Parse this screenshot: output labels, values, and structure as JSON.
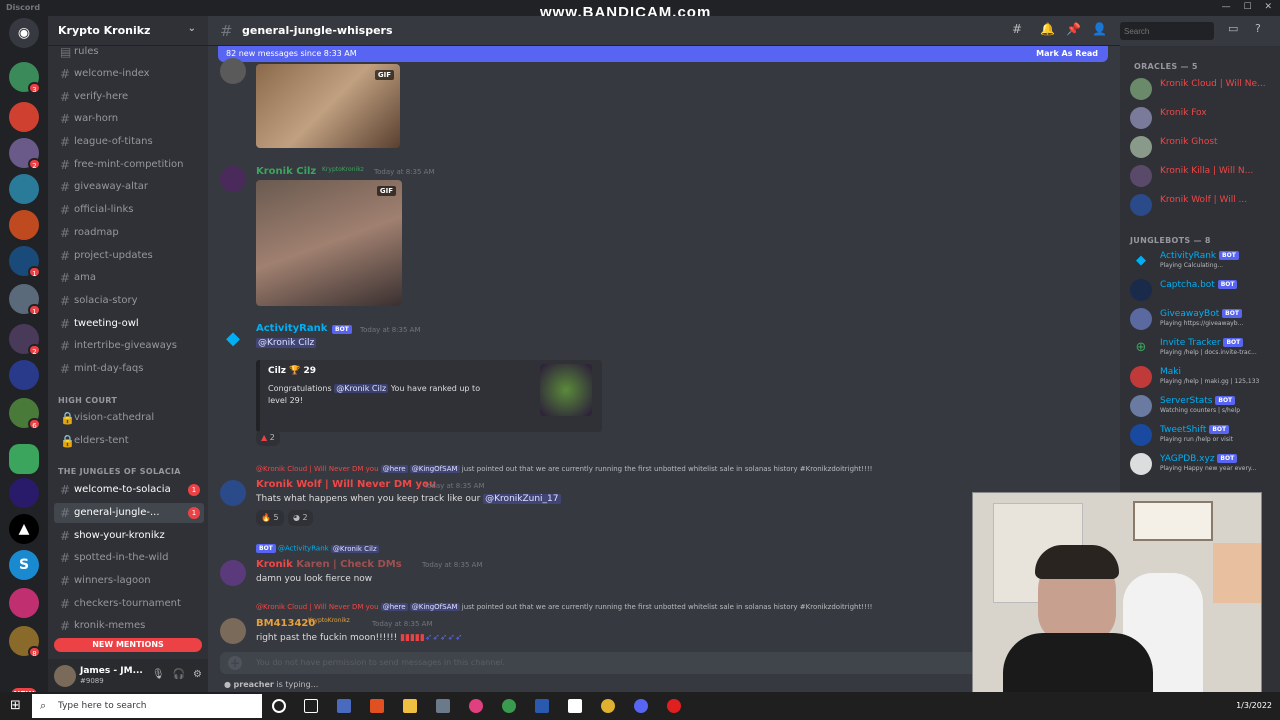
{
  "titlebar": {
    "app": "Discord",
    "watermark": "www.BANDICAM.com"
  },
  "server": {
    "name": "Krypto Kronikz"
  },
  "guild_badges": [
    "3",
    "2",
    "1",
    "1",
    "2",
    "6",
    "1",
    "8"
  ],
  "guild_new_label": "NEW",
  "channels": {
    "top": [
      {
        "label": "rules"
      },
      {
        "label": "welcome-index"
      },
      {
        "label": "verify-here"
      },
      {
        "label": "war-horn"
      },
      {
        "label": "league-of-titans"
      },
      {
        "label": "free-mint-competition"
      },
      {
        "label": "giveaway-altar"
      },
      {
        "label": "official-links"
      },
      {
        "label": "roadmap"
      },
      {
        "label": "project-updates"
      },
      {
        "label": "ama"
      },
      {
        "label": "solacia-story"
      },
      {
        "label": "tweeting-owl"
      },
      {
        "label": "intertribe-giveaways"
      },
      {
        "label": "mint-day-faqs"
      }
    ],
    "cat_high_court": "HIGH COURT",
    "high_court": [
      {
        "label": "vision-cathedral"
      },
      {
        "label": "elders-tent"
      }
    ],
    "cat_jungles": "THE JUNGLES OF SOLACIA",
    "jungles": [
      {
        "label": "welcome-to-solacia",
        "badge": "1"
      },
      {
        "label": "general-jungle-...",
        "badge": "1"
      },
      {
        "label": "show-your-kronikz"
      },
      {
        "label": "spotted-in-the-wild"
      },
      {
        "label": "winners-lagoon"
      },
      {
        "label": "checkers-tournament"
      },
      {
        "label": "kronik-memes"
      }
    ],
    "new_mentions": "NEW MENTIONS"
  },
  "user": {
    "name": "James - JM...",
    "tag": "#9089"
  },
  "chat": {
    "channel_title": "general-jungle-whispers",
    "new_messages": "82 new messages since 8:33 AM",
    "mark_read": "Mark As Read",
    "gif_label": "GIF",
    "search_placeholder": "Search",
    "msg1": {
      "author": "Kronik Cilz",
      "server_tag": "KryptoKronikz",
      "time": "Today at 8:35 AM"
    },
    "msg2": {
      "author": "ActivityRank",
      "bot": "BOT",
      "time": "Today at 8:35 AM",
      "mention": "@Kronik Cilz",
      "embed_title": "Cilz",
      "embed_level": "29",
      "embed_text_a": "Congratulations",
      "embed_mention": "@Kronik Cilz",
      "embed_text_b": "You have ranked up to",
      "embed_text_c": "level 29!",
      "reaction_count": "2"
    },
    "msg3": {
      "reply_author": "@Kronik Cloud | Will Never DM you",
      "reply_here": "@here",
      "reply_mention": "@KingOfSAM",
      "reply_text": "just pointed out that we are currently running the first unbotted whitelist sale in solanas history",
      "reply_tail": "#Kronikzdoitright!!!!",
      "author": "Kronik Wolf | Will Never DM you",
      "time": "Today at 8:35 AM",
      "text": "Thats what happens when you keep track like our",
      "mention": "@KronikZuni_17",
      "r1": "5",
      "r2": "2"
    },
    "msg4": {
      "reply_bot": "BOT",
      "reply_author": "@ActivityRank",
      "reply_mention": "@Kronik Cilz",
      "author": "Kronik",
      "author_tail": "Karen | Check DMs",
      "time": "Today at 8:35 AM",
      "text": "damn you look fierce now"
    },
    "msg5": {
      "reply_author": "@Kronik Cloud | Will Never DM you",
      "reply_here": "@here",
      "reply_mention": "@KingOfSAM",
      "reply_text": "just pointed out that we are currently running the first unbotted whitelist sale in solanas history",
      "reply_tail": "#Kronikzdoitright!!!!",
      "author": "BM413420",
      "server_tag": "KryptoKronikz",
      "time": "Today at 8:35 AM",
      "text": "right past the fuckin moon!!!!!!"
    },
    "composer_placeholder": "You do not have permission to send messages in this channel.",
    "typing_user": "preacher",
    "typing_text": "is typing..."
  },
  "members": {
    "cat_oracles": "ORACLES — 5",
    "oracles": [
      {
        "name": "Kronik Cloud | Will Ne..."
      },
      {
        "name": "Kronik Fox"
      },
      {
        "name": "Kronik Ghost"
      },
      {
        "name": "Kronik Killa | Will N..."
      },
      {
        "name": "Kronik Wolf | Will ..."
      }
    ],
    "cat_bots": "JUNGLEBOTS — 8",
    "bot_badge": "BOT",
    "bots": [
      {
        "name": "ActivityRank",
        "status": "Playing Calculating..."
      },
      {
        "name": "Captcha.bot",
        "status": ""
      },
      {
        "name": "GiveawayBot",
        "status": "Playing https://giveawayb..."
      },
      {
        "name": "Invite Tracker",
        "status": "Playing /help | docs.invite-trac..."
      },
      {
        "name": "Maki",
        "status": "Playing /help | maki.gg | 125,133"
      },
      {
        "name": "ServerStats",
        "status": "Watching counters | s/help"
      },
      {
        "name": "TweetShift",
        "status": "Playing run /help or visit"
      },
      {
        "name": "YAGPDB.xyz",
        "status": "Playing Happy new year every..."
      }
    ]
  },
  "taskbar": {
    "search": "Type here to search",
    "date": "1/3/2022"
  },
  "colors": {
    "oracle": "#f04747",
    "bot": "#00aff4",
    "accent": "#5865f2",
    "danger": "#ed4245"
  }
}
